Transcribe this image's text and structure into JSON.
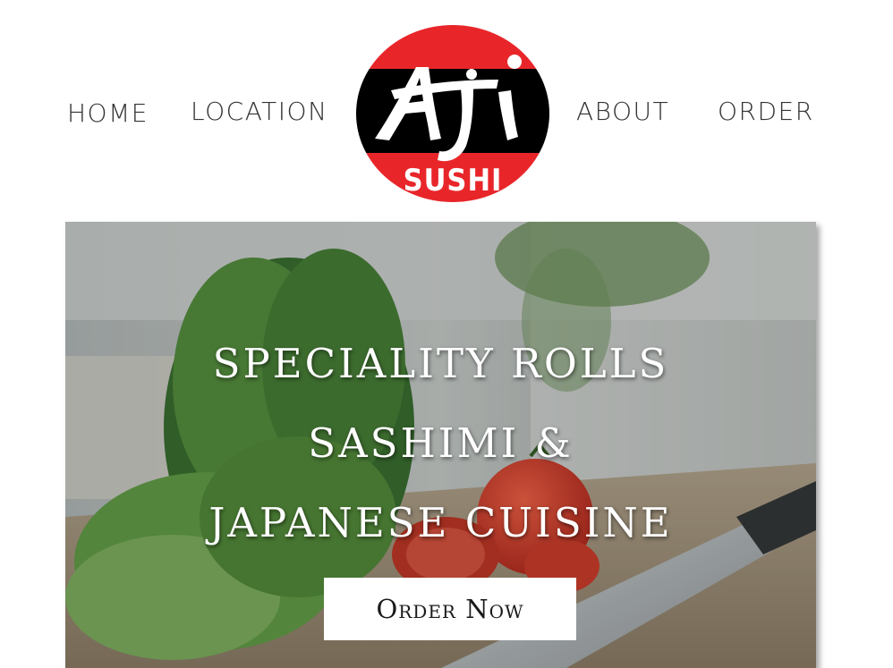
{
  "nav": {
    "home": "HOME",
    "location": "LOCATION",
    "about": "ABOUT",
    "order": "ORDER"
  },
  "logo": {
    "wordmark": "Aji",
    "subtitle": "SUSHI",
    "colors": {
      "red": "#e8262a",
      "black": "#000000",
      "white": "#ffffff"
    }
  },
  "hero": {
    "line1": "SPECIALITY ROLLS",
    "line2": "SASHIMI &",
    "line3": "JAPANESE CUISINE",
    "button_label": "Order Now",
    "image_subject": "lettuce, tomatoes and chef knife on cutting board"
  }
}
